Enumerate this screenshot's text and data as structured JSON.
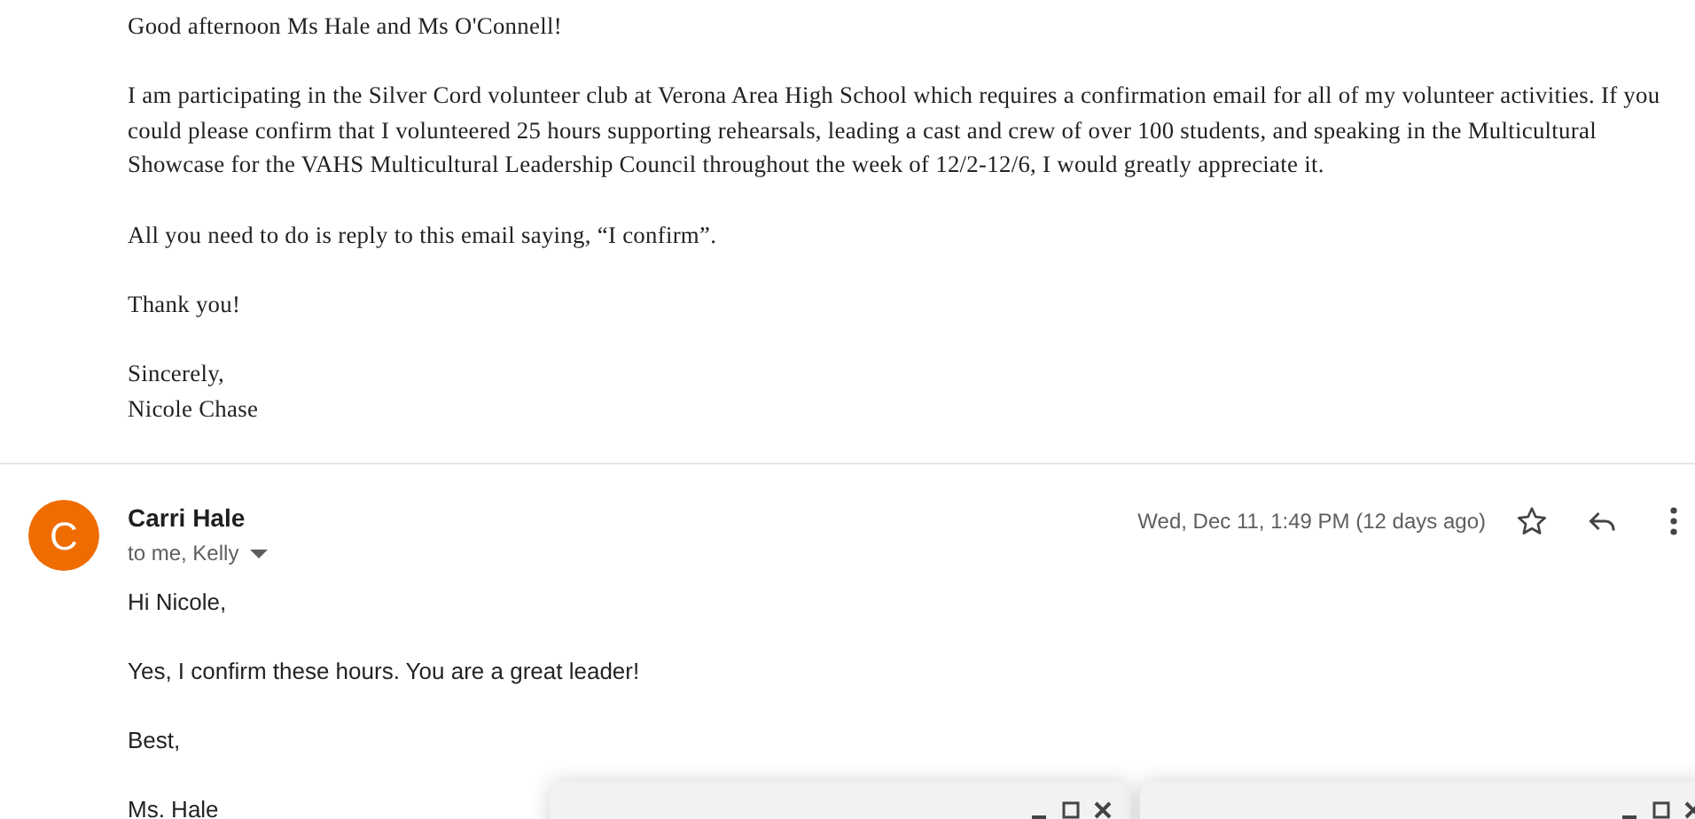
{
  "first_message": {
    "paragraphs": [
      [
        "Good afternoon Ms Hale and Ms O'Connell!"
      ],
      [
        "I am participating in the Silver Cord volunteer club at Verona Area High School which requires a confirmation email for all of my volunteer activities. If you could please confirm that I volunteered 25 hours supporting rehearsals, leading a cast and crew of over 100 students, and speaking in the Multicultural Showcase for the VAHS Multicultural Leadership Council throughout the week of 12/2-12/6, I would greatly appreciate it."
      ],
      [
        "All you need to do is reply to this email saying, “I confirm”."
      ],
      [
        "Thank you!"
      ],
      [
        "Sincerely,",
        "Nicole Chase"
      ]
    ]
  },
  "reply": {
    "avatar": "C",
    "sender": "Carri Hale",
    "recipients": "to me, Kelly",
    "date": "Wed, Dec 11, 1:49 PM (12 days ago)",
    "starred": false,
    "paragraphs": [
      [
        "Hi Nicole,"
      ],
      [
        "Yes, I confirm these hours.  You are a great leader!"
      ],
      [
        "Best,"
      ],
      [
        "Ms. Hale"
      ]
    ]
  },
  "compose_windows": [
    {
      "kind": "minimized"
    },
    {
      "kind": "minimized"
    }
  ]
}
